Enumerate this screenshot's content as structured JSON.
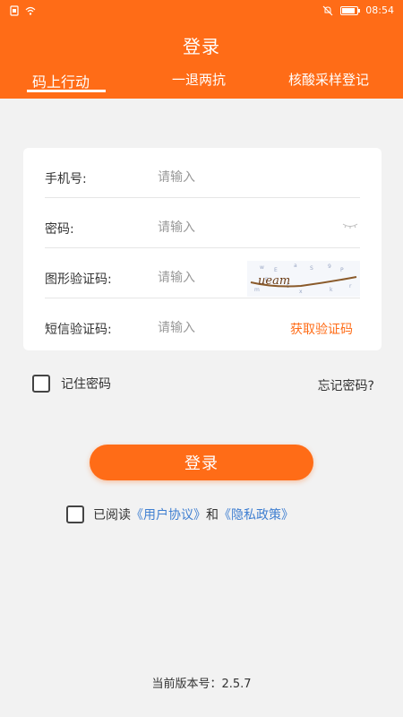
{
  "statusbar": {
    "time": "08:54",
    "icons": [
      "sim-icon",
      "wifi-icon",
      "mute-icon",
      "battery-icon"
    ]
  },
  "header": {
    "title": "登录",
    "tabs": [
      {
        "label": "码上行动",
        "active": true
      },
      {
        "label": "一退两抗",
        "active": false
      },
      {
        "label": "核酸采样登记",
        "active": false
      }
    ]
  },
  "form": {
    "phone": {
      "label": "手机号:",
      "placeholder": "请输入",
      "value": ""
    },
    "password": {
      "label": "密码:",
      "placeholder": "请输入",
      "value": ""
    },
    "captcha": {
      "label": "图形验证码:",
      "placeholder": "请输入",
      "value": "",
      "image_text": "ueam"
    },
    "sms": {
      "label": "短信验证码:",
      "placeholder": "请输入",
      "value": "",
      "button_label": "获取验证码"
    }
  },
  "options": {
    "remember_label": "记住密码",
    "forgot_label": "忘记密码?"
  },
  "login_button": "登录",
  "agreement": {
    "prefix": "已阅读",
    "user_agreement": "《用户协议》",
    "conjunction": "和",
    "privacy_policy": "《隐私政策》"
  },
  "version_text": "当前版本号：2.5.7",
  "colors": {
    "brand": "#ff6c17",
    "link": "#3f7fd1",
    "background": "#f2f2f2"
  }
}
